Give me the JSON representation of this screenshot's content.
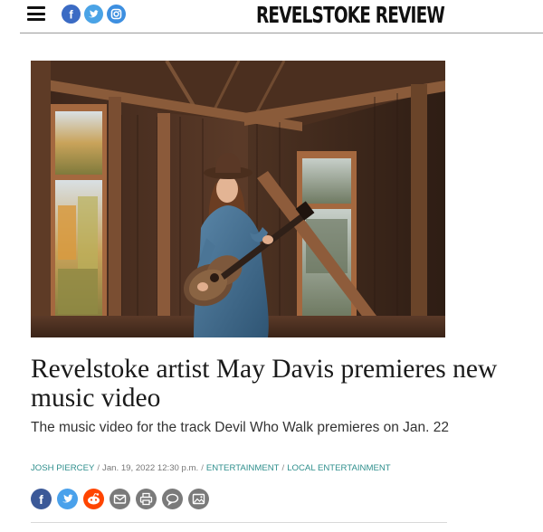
{
  "site": {
    "masthead": "REVELSTOKE REVIEW",
    "menu_icon": "hamburger-menu-icon",
    "social": [
      {
        "name": "facebook",
        "icon": "facebook-icon",
        "glyph": "f",
        "color": "#3b6bc4"
      },
      {
        "name": "twitter",
        "icon": "twitter-icon",
        "glyph": "t",
        "color": "#4aa3e6"
      },
      {
        "name": "instagram",
        "icon": "instagram-icon",
        "glyph": "",
        "color": "#3d8fe0"
      }
    ]
  },
  "article": {
    "headline": "Revelstoke artist May Davis premieres new music video",
    "subhead": "The music video for the track Devil Who Walk premieres on Jan. 22",
    "author": "JOSH PIERCEY",
    "date": "Jan. 19, 2022 12:30 p.m.",
    "categories": [
      "ENTERTAINMENT",
      "LOCAL ENTERTAINMENT"
    ],
    "separator": "/"
  },
  "share": [
    {
      "name": "facebook",
      "icon": "facebook-icon",
      "color": "#3b5998"
    },
    {
      "name": "twitter",
      "icon": "twitter-icon",
      "color": "#4aa1eb"
    },
    {
      "name": "reddit",
      "icon": "reddit-icon",
      "color": "#ff4500"
    },
    {
      "name": "email",
      "icon": "envelope-icon",
      "color": "#7a7a7a"
    },
    {
      "name": "print",
      "icon": "printer-icon",
      "color": "#7a7a7a"
    },
    {
      "name": "comment",
      "icon": "comment-icon",
      "color": "#7a7a7a"
    },
    {
      "name": "gallery",
      "icon": "image-icon",
      "color": "#7a7a7a"
    }
  ]
}
